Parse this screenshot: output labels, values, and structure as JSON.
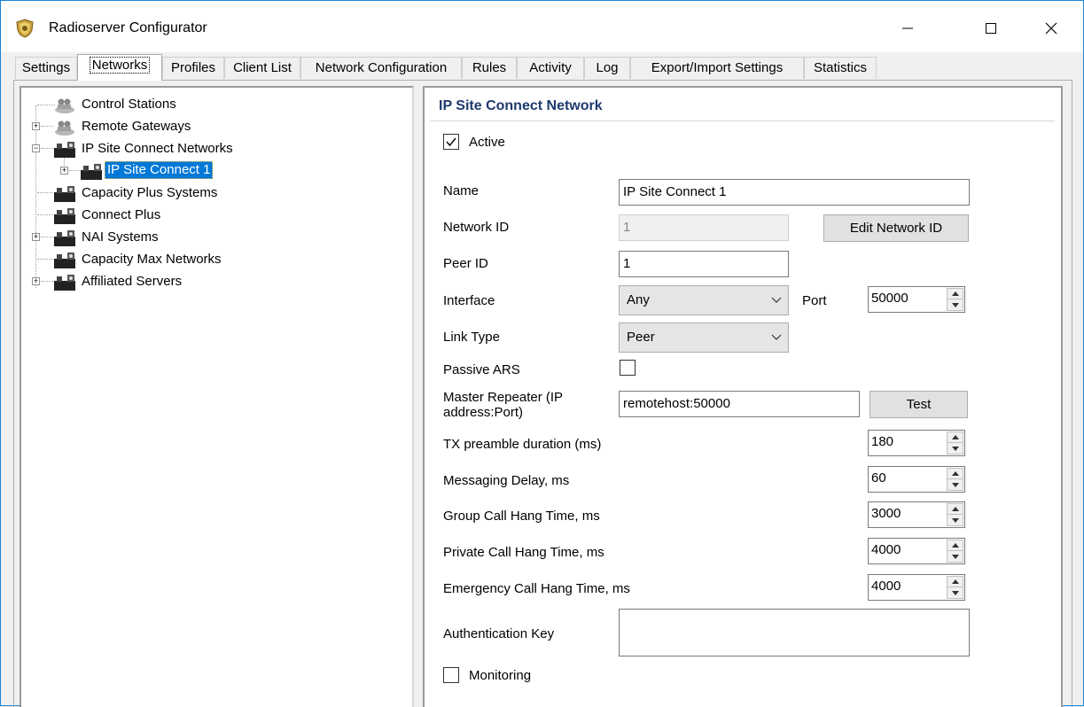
{
  "window": {
    "title": "Radioserver Configurator"
  },
  "tabs": [
    {
      "label": "Settings"
    },
    {
      "label": "Networks"
    },
    {
      "label": "Profiles"
    },
    {
      "label": "Client List"
    },
    {
      "label": "Network Configuration"
    },
    {
      "label": "Rules"
    },
    {
      "label": "Activity"
    },
    {
      "label": "Log"
    },
    {
      "label": "Export/Import Settings"
    },
    {
      "label": "Statistics"
    }
  ],
  "tree": {
    "items": [
      {
        "label": "Control Stations",
        "icon": "control-stations-icon"
      },
      {
        "label": "Remote Gateways",
        "icon": "remote-gateways-icon"
      },
      {
        "label": "IP Site Connect Networks",
        "icon": "network-icon"
      },
      {
        "label": "IP Site Connect 1",
        "icon": "network-icon",
        "selected": true
      },
      {
        "label": "Capacity Plus Systems",
        "icon": "network-icon"
      },
      {
        "label": "Connect Plus",
        "icon": "network-icon"
      },
      {
        "label": "NAI Systems",
        "icon": "network-icon"
      },
      {
        "label": "Capacity Max Networks",
        "icon": "network-icon"
      },
      {
        "label": "Affiliated Servers",
        "icon": "network-icon"
      }
    ]
  },
  "form": {
    "section_title": "IP Site Connect Network",
    "active_label": "Active",
    "active_checked": true,
    "name_label": "Name",
    "name_value": "IP Site Connect 1",
    "network_id_label": "Network ID",
    "network_id_value": "1",
    "edit_network_id_label": "Edit Network ID",
    "peer_id_label": "Peer ID",
    "peer_id_value": "1",
    "interface_label": "Interface",
    "interface_value": "Any",
    "port_label": "Port",
    "port_value": "50000",
    "link_type_label": "Link Type",
    "link_type_value": "Peer",
    "passive_ars_label": "Passive ARS",
    "passive_ars_checked": false,
    "master_repeater_label_line1": "Master Repeater (IP",
    "master_repeater_label_line2": "address:Port)",
    "master_repeater_value": "remotehost:50000",
    "test_label": "Test",
    "tx_preamble_label": "TX preamble duration (ms)",
    "tx_preamble_value": "180",
    "messaging_delay_label": "Messaging Delay, ms",
    "messaging_delay_value": "60",
    "group_call_label": "Group Call Hang Time, ms",
    "group_call_value": "3000",
    "private_call_label": "Private Call Hang Time, ms",
    "private_call_value": "4000",
    "emergency_call_label": "Emergency Call Hang Time, ms",
    "emergency_call_value": "4000",
    "auth_key_label": "Authentication Key",
    "auth_key_value": "",
    "monitoring_label": "Monitoring",
    "monitoring_checked": false
  }
}
